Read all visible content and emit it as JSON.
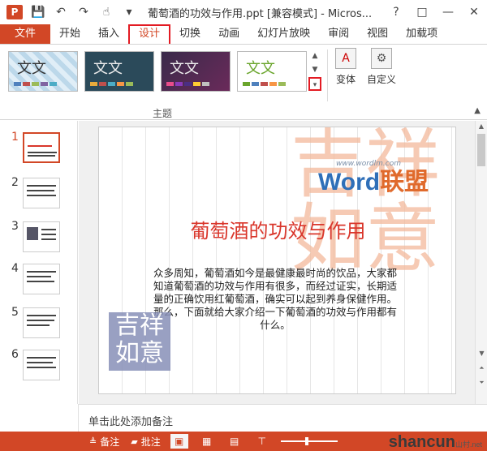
{
  "titlebar": {
    "app_icon": "P",
    "title": "葡萄酒的功效与作用.ppt [兼容模式] - Micros...",
    "quick_access": [
      "save-icon",
      "undo-icon",
      "redo-icon",
      "touch-mode-icon",
      "customize-icon"
    ],
    "controls": [
      "?",
      "□",
      "—",
      "✕"
    ]
  },
  "tabs": {
    "file": "文件",
    "items": [
      "开始",
      "插入",
      "设计",
      "切换",
      "动画",
      "幻灯片放映",
      "审阅",
      "视图",
      "加载项"
    ],
    "active": "设计"
  },
  "ribbon": {
    "themes": [
      {
        "label": "文文",
        "swatches": [
          "#4f81bd",
          "#c0504d",
          "#9bbb59",
          "#8064a2",
          "#4bacc6"
        ]
      },
      {
        "label": "文文",
        "swatches": [
          "#e8ab3c",
          "#c0504d",
          "#4bacc6",
          "#f79646",
          "#9bbb59"
        ]
      },
      {
        "label": "文文",
        "swatches": [
          "#e84c8a",
          "#8a3ab9",
          "#4b2e83",
          "#ffcc33",
          "#c0c0c0"
        ]
      },
      {
        "label": "文文",
        "swatches": [
          "#6aa52c",
          "#4f81bd",
          "#c0504d",
          "#f79646",
          "#9bbb59"
        ]
      }
    ],
    "variant_label": "变体",
    "custom_label": "自定义",
    "group_label": "主题"
  },
  "slides": {
    "numbers": [
      "1",
      "2",
      "3",
      "4",
      "5",
      "6"
    ],
    "active": "1"
  },
  "slide": {
    "logo_url": "www.wordlm.com",
    "logo_word": "Word",
    "logo_cn": "联盟",
    "calligraphy": "吉祥如意",
    "title": "葡萄酒的功效与作用",
    "body": "众多周知，葡萄酒如今是最健康最时尚的饮品，大家都知道葡萄酒的功效与作用有很多，而经过证实，长期适量的正确饮用红葡萄酒，确实可以起到养身保健作用。那么，下面就给大家介绍一下葡萄酒的功效与作用都有什么。",
    "stamp": "吉祥如意"
  },
  "notes": {
    "placeholder": "单击此处添加备注"
  },
  "statusbar": {
    "notes_label": "备注",
    "comments_label": "批注",
    "watermark_main": "shancun",
    "watermark_cn": "山村",
    "watermark_tld": ".net"
  }
}
